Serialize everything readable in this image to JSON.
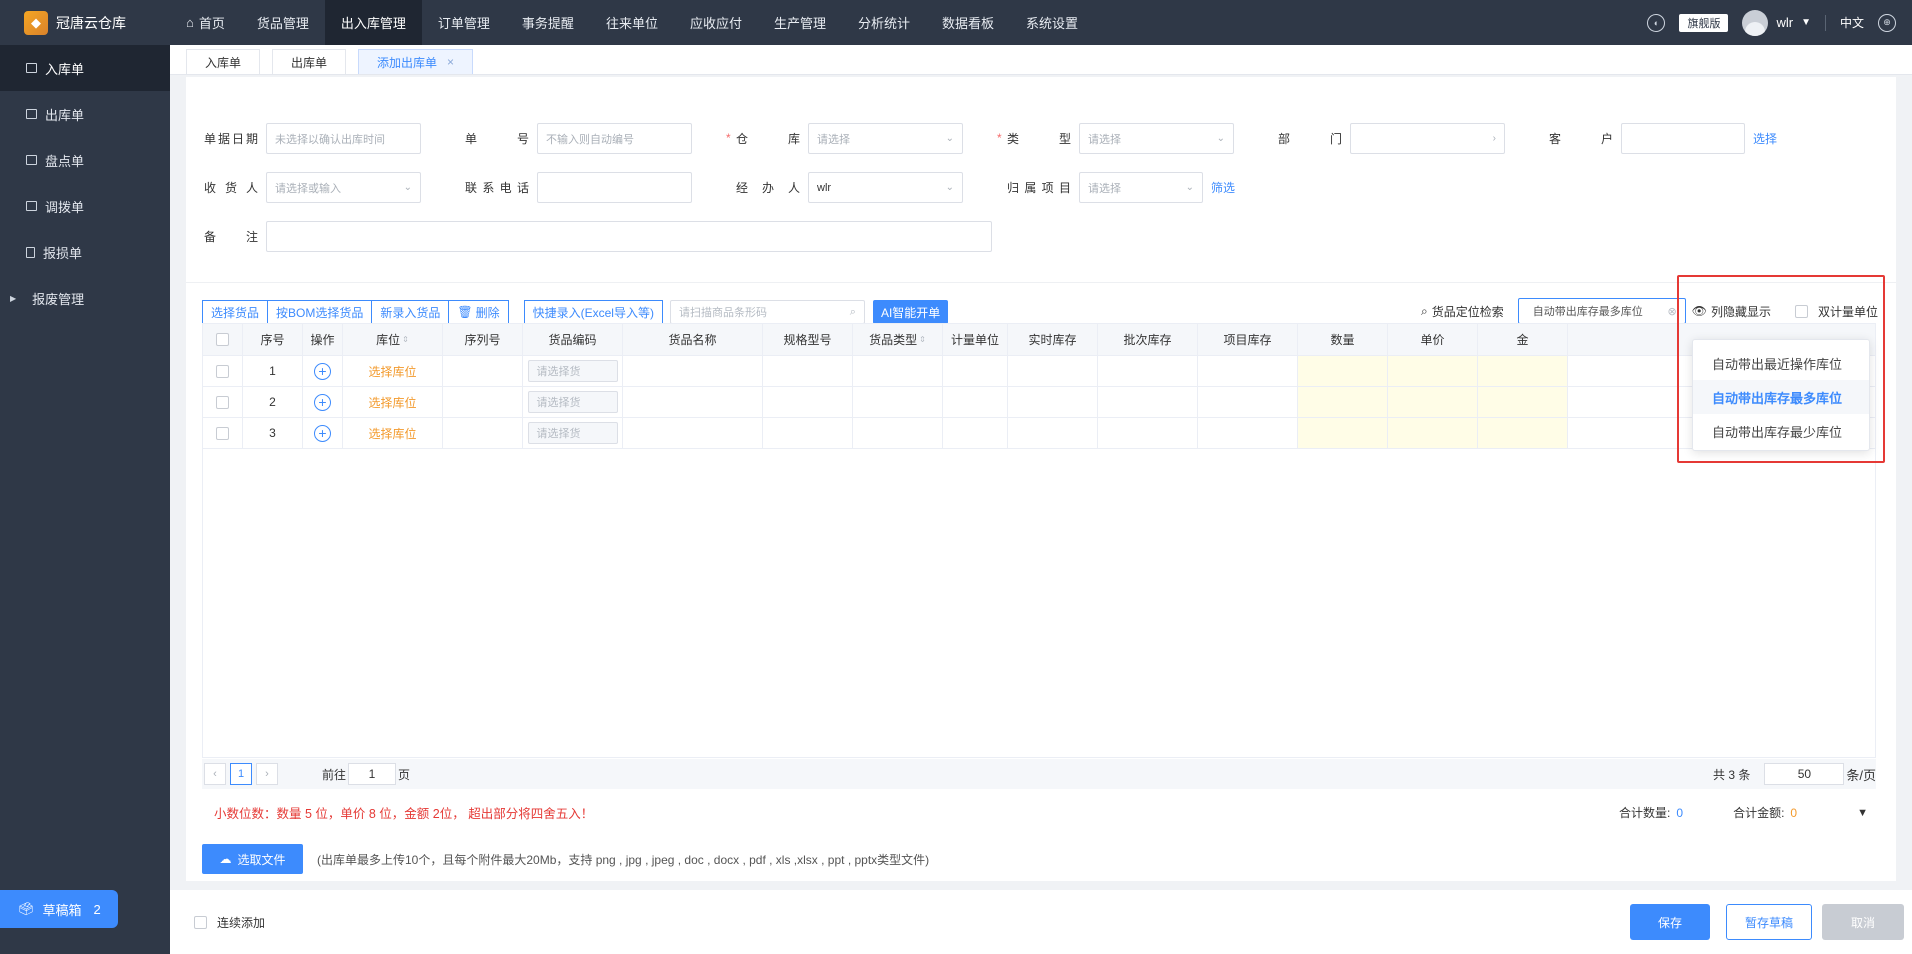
{
  "brand": {
    "name": "冠唐云仓库"
  },
  "topnav": {
    "items": [
      "首页",
      "货品管理",
      "出入库管理",
      "订单管理",
      "事务提醒",
      "往来单位",
      "应收应付",
      "生产管理",
      "分析统计",
      "数据看板",
      "系统设置"
    ],
    "active_index": 2
  },
  "topright": {
    "version": "旗舰版",
    "user": "wlr",
    "lang": "中文"
  },
  "sidebar": {
    "items": [
      "入库单",
      "出库单",
      "盘点单",
      "调拨单",
      "报损单",
      "报废管理"
    ],
    "active_index": 0
  },
  "draft": {
    "label": "草稿箱",
    "count": "2"
  },
  "tabs": [
    {
      "label": "入库单"
    },
    {
      "label": "出库单"
    },
    {
      "label": "添加出库单"
    }
  ],
  "form": {
    "date": {
      "label": "单据日期",
      "placeholder": "未选择以确认出库时间"
    },
    "number": {
      "label": "单号",
      "placeholder": "不输入则自动编号"
    },
    "warehouse": {
      "label": "仓库",
      "placeholder": "请选择"
    },
    "type": {
      "label": "类型",
      "placeholder": "请选择"
    },
    "dept": {
      "label": "部门",
      "placeholder": ""
    },
    "customer": {
      "label": "客户",
      "placeholder": "",
      "link": "选择"
    },
    "receiver": {
      "label": "收货人",
      "placeholder": "请选择或输入"
    },
    "phone": {
      "label": "联系电话",
      "placeholder": ""
    },
    "handler": {
      "label": "经办人",
      "value": "wlr"
    },
    "project": {
      "label": "归属项目",
      "placeholder": "请选择",
      "link": "筛选"
    },
    "note": {
      "label": "备注",
      "placeholder": ""
    }
  },
  "toolbar": {
    "select_goods": "选择货品",
    "bom_select": "按BOM选择货品",
    "new_goods": "新录入货品",
    "delete": "删除",
    "quick_entry": "快捷录入(Excel导入等)",
    "scan_placeholder": "请扫描商品条形码",
    "ai": "AI智能开单"
  },
  "right_tools": {
    "locate": "货品定位检索",
    "location_select": "自动带出库存最多库位",
    "hidden_cols": "列隐藏显示",
    "dual_unit": "双计量单位"
  },
  "dropdown": {
    "options": [
      "自动带出最近操作库位",
      "自动带出库存最多库位",
      "自动带出库存最少库位"
    ],
    "selected_index": 1
  },
  "table": {
    "headers": [
      "序号",
      "操作",
      "库位",
      "序列号",
      "货品编码",
      "货品名称",
      "规格型号",
      "货品类型",
      "计量单位",
      "实时库存",
      "批次库存",
      "项目库存",
      "数量",
      "单价",
      "金"
    ],
    "rows": [
      {
        "no": "1",
        "location": "选择库位",
        "code_ph": "请选择货"
      },
      {
        "no": "2",
        "location": "选择库位",
        "code_ph": "请选择货"
      },
      {
        "no": "3",
        "location": "选择库位",
        "code_ph": "请选择货"
      }
    ]
  },
  "pager": {
    "current": "1",
    "goto_prefix": "前往",
    "goto_value": "1",
    "goto_suffix": "页",
    "total": "共 3 条",
    "page_size": "50",
    "page_size_suffix": "条/页"
  },
  "summary": {
    "note": "小数位数：数量 5 位，单价 8 位，金额 2位， 超出部分将四舍五入！",
    "total_qty_label": "合计数量:",
    "total_qty": "0",
    "total_amt_label": "合计金额:",
    "total_amt": "0"
  },
  "upload": {
    "button": "选取文件",
    "hint": "(出库单最多上传10个，且每个附件最大20Mb，支持 png , jpg , jpeg , doc , docx , pdf , xls ,xlsx , ppt , pptx类型文件)"
  },
  "footer": {
    "continuous": "连续添加",
    "save": "保存",
    "draft": "暂存草稿",
    "cancel": "取消"
  },
  "colors": {
    "primary": "#3d8bfd",
    "nav_bg": "#2f3847",
    "warning": "#f39a2c",
    "danger": "#e53935"
  }
}
